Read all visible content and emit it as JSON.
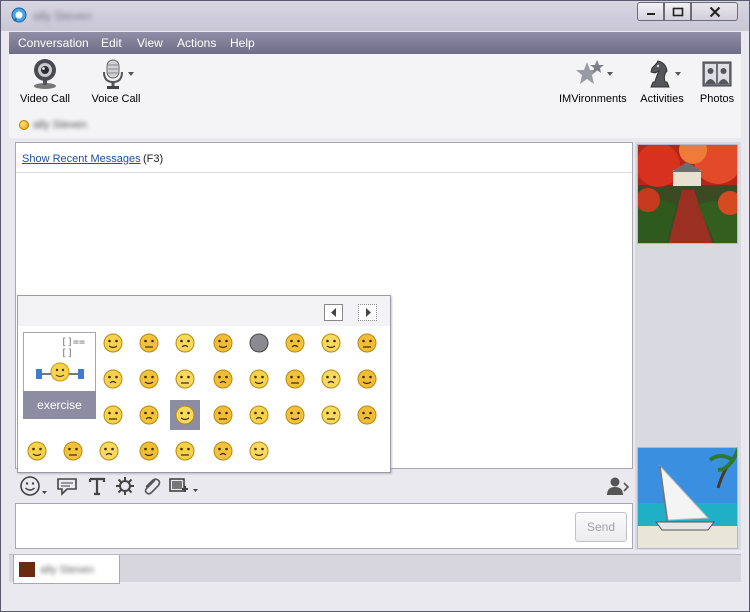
{
  "window": {
    "title": "ally Steven",
    "controls": {
      "minimize": "minimize",
      "maximize": "maximize",
      "close": "close"
    }
  },
  "menu": [
    "Conversation",
    "Edit",
    "View",
    "Actions",
    "Help"
  ],
  "toolbar": {
    "left": [
      {
        "label": "Video Call",
        "icon": "webcam-icon"
      },
      {
        "label": "Voice Call",
        "icon": "microphone-icon"
      }
    ],
    "right": [
      {
        "label": "IMVironments",
        "icon": "imvironments-icon"
      },
      {
        "label": "Activities",
        "icon": "chess-knight-icon"
      },
      {
        "label": "Photos",
        "icon": "photos-icon"
      }
    ]
  },
  "contact": {
    "name": "ally Steven",
    "status_color": "#f2b800"
  },
  "conversation": {
    "recent_link": "Show Recent Messages",
    "recent_shortcut": "(F3)"
  },
  "emoticons": {
    "preview_code": "[]==[]",
    "preview_name": "exercise",
    "selected_index": 18
  },
  "compose": {
    "send_label": "Send"
  },
  "tab": {
    "name": "ally Steven"
  }
}
